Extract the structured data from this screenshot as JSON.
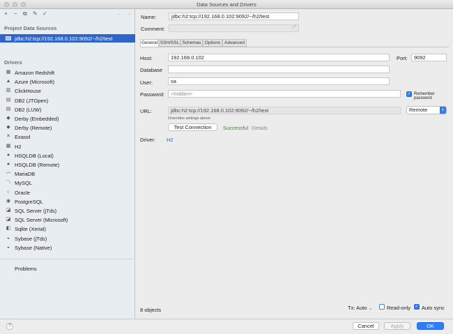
{
  "window": {
    "title": "Data Sources and Drivers"
  },
  "toolbar": {
    "add": "+",
    "remove": "−",
    "copy": "⧉",
    "settings": "✎",
    "import": "✓",
    "back": "←",
    "forward": "→"
  },
  "left": {
    "project_header": "Project Data Sources",
    "data_source": "jdbc:h2:tcp://192.168.0.102:9092/~/h2/test",
    "drivers_header": "Drivers",
    "drivers": [
      {
        "label": "Amazon Redshift",
        "icon": "▦"
      },
      {
        "label": "Azure (Microsoft)",
        "icon": "▲"
      },
      {
        "label": "ClickHouse",
        "icon": "▥"
      },
      {
        "label": "DB2 (JTOpen)",
        "icon": "▤"
      },
      {
        "label": "DB2 (LUW)",
        "icon": "▤"
      },
      {
        "label": "Derby (Embedded)",
        "icon": "◆"
      },
      {
        "label": "Derby (Remote)",
        "icon": "◆"
      },
      {
        "label": "Exasol",
        "icon": "✕"
      },
      {
        "label": "H2",
        "icon": "▦"
      },
      {
        "label": "HSQLDB (Local)",
        "icon": "●"
      },
      {
        "label": "HSQLDB (Remote)",
        "icon": "●"
      },
      {
        "label": "MariaDB",
        "icon": "〰"
      },
      {
        "label": "MySQL",
        "icon": "〽"
      },
      {
        "label": "Oracle",
        "icon": "○"
      },
      {
        "label": "PostgreSQL",
        "icon": "◉"
      },
      {
        "label": "SQL Server (jTds)",
        "icon": "◪"
      },
      {
        "label": "SQL Server (Microsoft)",
        "icon": "◪"
      },
      {
        "label": "Sqlite (Xerial)",
        "icon": "◧"
      },
      {
        "label": "Sybase (jTds)",
        "icon": "◒"
      },
      {
        "label": "Sybase (Native)",
        "icon": "◒"
      }
    ],
    "problems": "Problems"
  },
  "form": {
    "name_label": "Name:",
    "name_value": "jdbc:h2:tcp://192.168.0.102:9092/~/h2/test",
    "comment_label": "Comment:",
    "comment_value": "",
    "tabs": [
      "General",
      "SSH/SSL",
      "Schemas",
      "Options",
      "Advanced"
    ],
    "host_label": "Host:",
    "host_value": "192.168.0.102",
    "port_label": "Port:",
    "port_value": "9092",
    "database_label": "Database",
    "database_value": "",
    "user_label": "User:",
    "user_value": "sa",
    "password_label": "Password:",
    "password_placeholder": "<hidden>",
    "remember_label": "Remember password",
    "url_label": "URL:",
    "url_value": "jdbc:h2:tcp://192.168.0.102:9092/~/h2/test",
    "url_mode": "Remote",
    "url_hint": "Overrides settings above",
    "test_button": "Test Connection",
    "test_status": "Successful",
    "details_link": "Details",
    "driver_label": "Driver:",
    "driver_value": "H2",
    "objects_count": "8 objects",
    "tx_label": "Tx: Auto",
    "readonly_label": "Read-only",
    "autosync_label": "Auto sync"
  },
  "footer": {
    "help": "?",
    "cancel": "Cancel",
    "apply": "Apply",
    "ok": "OK"
  },
  "colors": {
    "selection": "#2f65ca",
    "accent": "#2f7cf6",
    "success": "#3b8a2e",
    "link": "#2b6bbf"
  }
}
